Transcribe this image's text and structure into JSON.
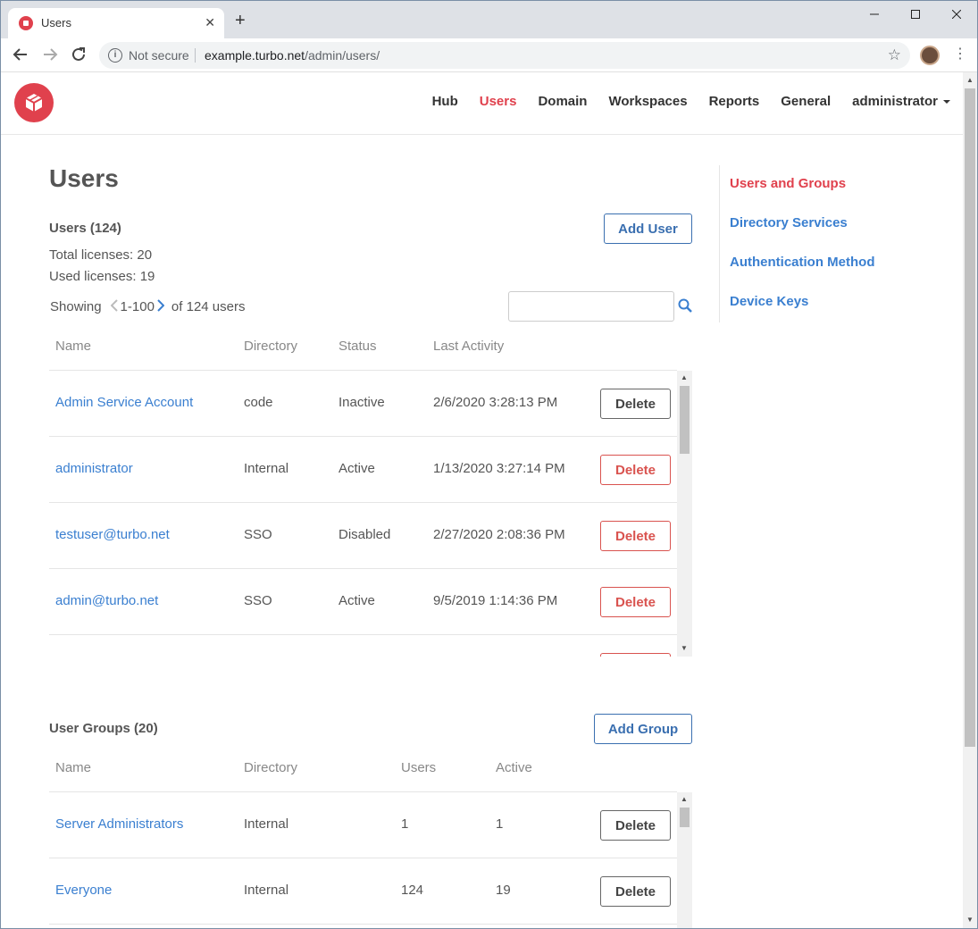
{
  "browser": {
    "tab_title": "Users",
    "tab_close": "✕",
    "new_tab": "+",
    "security_label": "Not secure",
    "url_host": "example.turbo.net",
    "url_path": "/admin/users/"
  },
  "nav": {
    "items": [
      "Hub",
      "Users",
      "Domain",
      "Workspaces",
      "Reports",
      "General"
    ],
    "active": "Users",
    "user": "administrator"
  },
  "page": {
    "title": "Users"
  },
  "users": {
    "section_title": "Users (124)",
    "add_label": "Add User",
    "total_licenses": "Total licenses: 20",
    "used_licenses": "Used licenses: 19",
    "showing_label": "Showing",
    "range": "1-100",
    "of_label": "of 124 users",
    "search_placeholder": "",
    "columns": [
      "Name",
      "Directory",
      "Status",
      "Last Activity"
    ],
    "rows": [
      {
        "name": "Admin Service Account",
        "directory": "code",
        "status": "Inactive",
        "last_activity": "2/6/2020 3:28:13 PM",
        "delete": "Delete",
        "delete_style": "grey"
      },
      {
        "name": "administrator",
        "directory": "Internal",
        "status": "Active",
        "last_activity": "1/13/2020 3:27:14 PM",
        "delete": "Delete",
        "delete_style": "red"
      },
      {
        "name": "testuser@turbo.net",
        "directory": "SSO",
        "status": "Disabled",
        "last_activity": "2/27/2020 2:08:36 PM",
        "delete": "Delete",
        "delete_style": "red"
      },
      {
        "name": "admin@turbo.net",
        "directory": "SSO",
        "status": "Active",
        "last_activity": "9/5/2019 1:14:36 PM",
        "delete": "Delete",
        "delete_style": "red"
      }
    ]
  },
  "groups": {
    "section_title": "User Groups (20)",
    "add_label": "Add Group",
    "columns": [
      "Name",
      "Directory",
      "Users",
      "Active"
    ],
    "rows": [
      {
        "name": "Server Administrators",
        "directory": "Internal",
        "users": "1",
        "active": "1",
        "delete": "Delete"
      },
      {
        "name": "Everyone",
        "directory": "Internal",
        "users": "124",
        "active": "19",
        "delete": "Delete"
      }
    ]
  },
  "sidenav": {
    "items": [
      "Users and Groups",
      "Directory Services",
      "Authentication Method",
      "Device Keys"
    ],
    "active": "Users and Groups"
  },
  "colors": {
    "accent_red": "#e0414d",
    "link_blue": "#3a7fd0",
    "button_blue": "#3a6fb0",
    "delete_red": "#d9534f"
  }
}
